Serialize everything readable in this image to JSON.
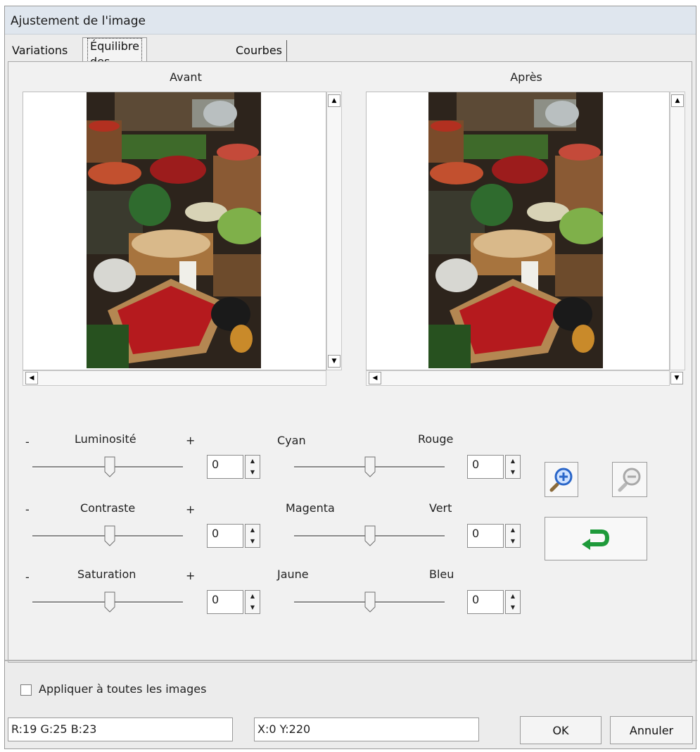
{
  "window": {
    "title": "Ajustement de l'image"
  },
  "tabs": [
    {
      "label": "Variations"
    },
    {
      "label": "Équilibre des couleurs"
    },
    {
      "label": "Courbes et niveaux"
    }
  ],
  "preview": {
    "before_label": "Avant",
    "after_label": "Après"
  },
  "left_sliders": [
    {
      "minus": "-",
      "label": "Luminosité",
      "plus": "+",
      "value": "0",
      "level": 0.5
    },
    {
      "minus": "-",
      "label": "Contraste",
      "plus": "+",
      "value": "0",
      "level": 0.5
    },
    {
      "minus": "-",
      "label": "Saturation",
      "plus": "+",
      "value": "0",
      "level": 0.5
    }
  ],
  "color_sliders": [
    {
      "left_label": "Cyan",
      "right_label": "Rouge",
      "value": "0",
      "level": 0.5
    },
    {
      "left_label": "Magenta",
      "right_label": "Vert",
      "value": "0",
      "level": 0.5
    },
    {
      "left_label": "Jaune",
      "right_label": "Bleu",
      "value": "0",
      "level": 0.5
    }
  ],
  "apply_all": {
    "label": "Appliquer à toutes les images",
    "checked": false
  },
  "status": {
    "rgb": "R:19 G:25 B:23",
    "xy": "X:0 Y:220"
  },
  "buttons": {
    "ok": "OK",
    "cancel": "Annuler"
  },
  "icons": {
    "zoom_in": "zoom-in-icon",
    "zoom_out": "zoom-out-icon",
    "reset": "undo-arrow-icon"
  },
  "colors": {
    "reset_arrow": "#1e9a3a",
    "zoom_lens": "#2a66c9"
  }
}
